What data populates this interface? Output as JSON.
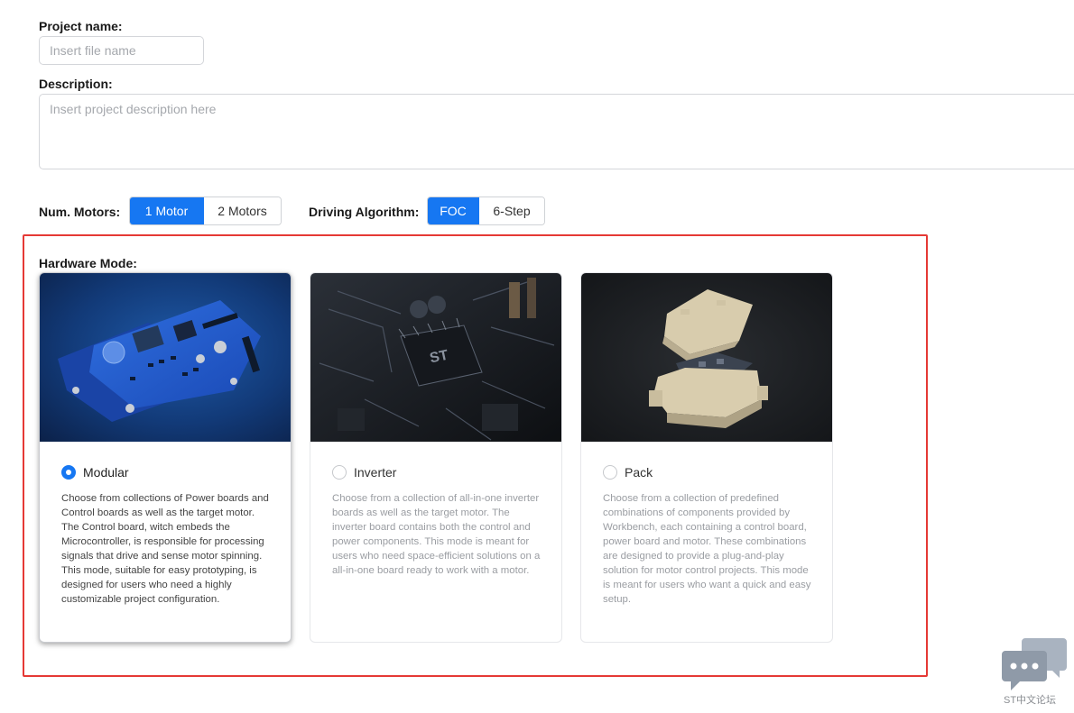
{
  "project": {
    "name_label": "Project name:",
    "name_placeholder": "Insert file name",
    "description_label": "Description:",
    "description_placeholder": "Insert project description here"
  },
  "num_motors": {
    "label": "Num. Motors:",
    "options": [
      "1 Motor",
      "2 Motors"
    ],
    "selected": "1 Motor"
  },
  "driving_algorithm": {
    "label": "Driving Algorithm:",
    "options": [
      "FOC",
      "6-Step"
    ],
    "selected": "FOC"
  },
  "hardware_mode": {
    "label": "Hardware Mode:",
    "cards": [
      {
        "title": "Modular",
        "selected": true,
        "description": "Choose from collections of Power boards and Control boards as well as the target motor. The Control board, witch embeds the Microcontroller, is responsible for processing signals that drive and sense motor spinning. This mode, suitable for easy prototyping, is designed for users who need a highly customizable project configuration."
      },
      {
        "title": "Inverter",
        "selected": false,
        "description": "Choose from a collection of all-in-one inverter boards as well as the target motor. The inverter board contains both the control and power components. This mode is meant for users who need space-efficient solutions on a all-in-one board ready to work with a motor."
      },
      {
        "title": "Pack",
        "selected": false,
        "description": "Choose from a collection of predefined combinations of components provided by Workbench, each containing a control board, power board and motor. These combinations are designed to provide a plug-and-play solution for motor control projects. This mode is meant for users who want a quick and easy setup."
      }
    ]
  },
  "watermark": {
    "text": "ST中文论坛",
    "icon": "chat-bubbles-icon"
  },
  "colors": {
    "accent": "#1677f2",
    "highlight_border": "#e53935"
  }
}
